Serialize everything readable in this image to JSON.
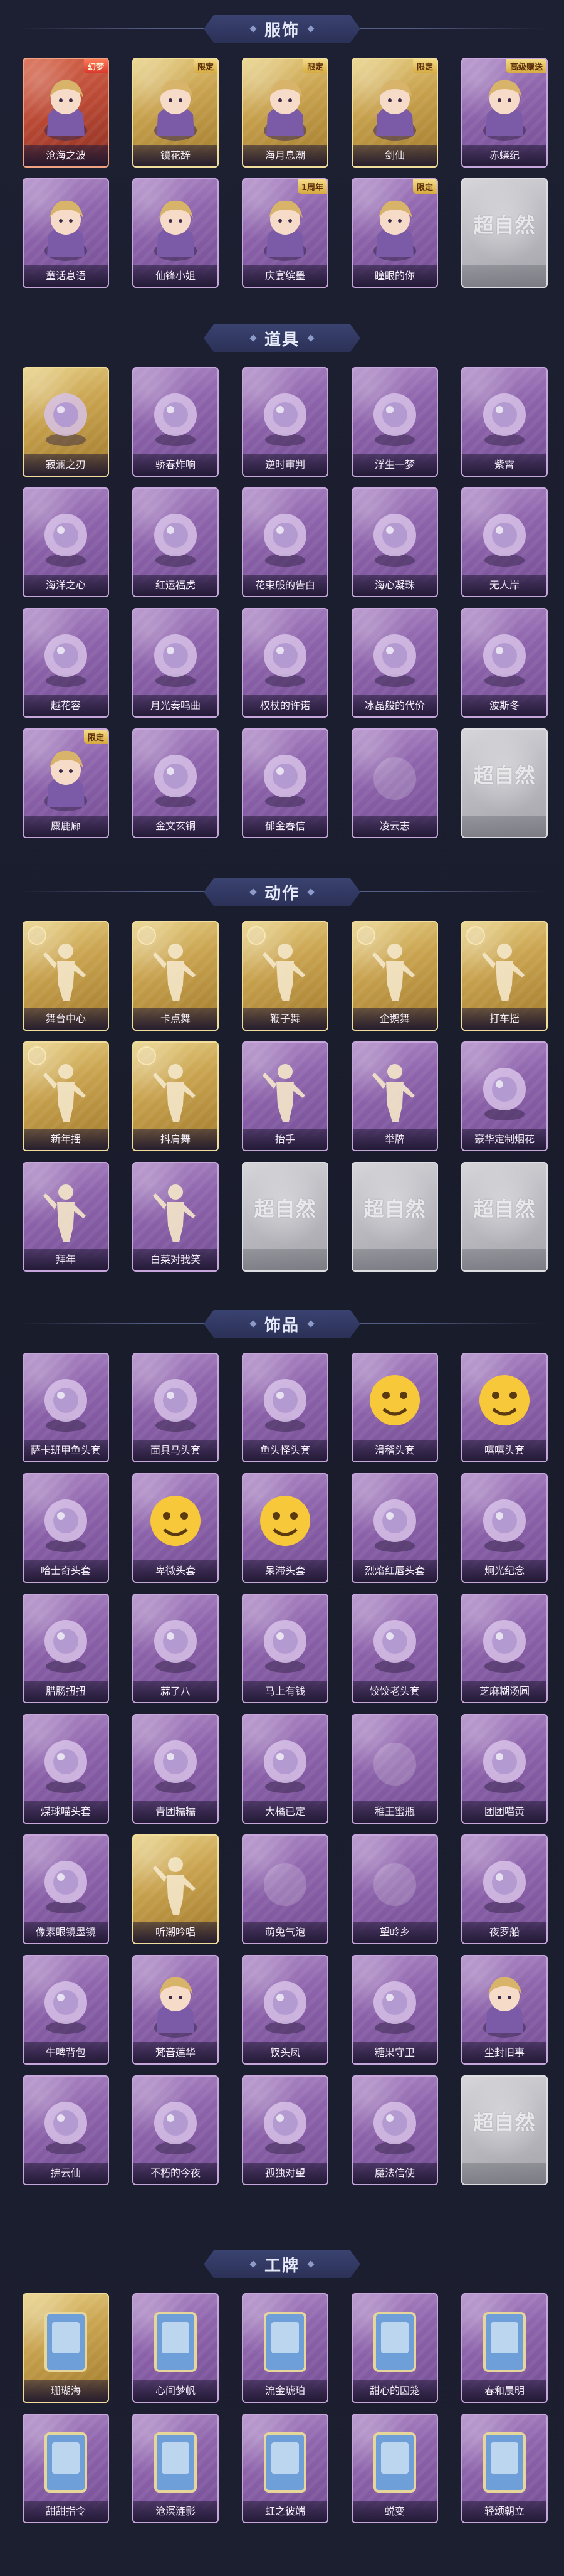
{
  "sections": [
    {
      "title": "服饰",
      "items": [
        {
          "label": "沧海之波",
          "style": "red",
          "badge": "幻梦",
          "icon": "character-icon"
        },
        {
          "label": "镜花辞",
          "style": "gold",
          "badge": "限定",
          "icon": "character-icon"
        },
        {
          "label": "海月息潮",
          "style": "gold",
          "badge": "限定",
          "icon": "character-icon"
        },
        {
          "label": "剑仙",
          "style": "gold",
          "badge": "限定",
          "icon": "character-icon"
        },
        {
          "label": "赤蝶纪",
          "style": "purple",
          "badge": "高级赠送",
          "icon": "character-icon"
        },
        {
          "label": "童话息语",
          "style": "purple",
          "badge": "",
          "icon": "character-icon"
        },
        {
          "label": "仙锋小姐",
          "style": "purple",
          "badge": "",
          "icon": "character-icon"
        },
        {
          "label": "庆宴缤墨",
          "style": "purple",
          "badge": "1周年",
          "icon": "character-icon"
        },
        {
          "label": "瞳眼的你",
          "style": "purple",
          "badge": "限定",
          "icon": "character-icon"
        },
        {
          "label": "",
          "style": "blank",
          "badge": "",
          "icon": "placeholder-icon"
        }
      ]
    },
    {
      "title": "道具",
      "items": [
        {
          "label": "寂澜之刃",
          "style": "gold",
          "badge": "",
          "icon": "blade-icon"
        },
        {
          "label": "骄春炸响",
          "style": "purple",
          "badge": "",
          "icon": "firecracker-icon"
        },
        {
          "label": "逆时审判",
          "style": "purple",
          "badge": "",
          "icon": "pocket-watch-icon"
        },
        {
          "label": "浮生一梦",
          "style": "purple",
          "badge": "",
          "icon": "hourglass-icon"
        },
        {
          "label": "紫霄",
          "style": "purple",
          "badge": "",
          "icon": "necklace-icon"
        },
        {
          "label": "海洋之心",
          "style": "purple",
          "badge": "",
          "icon": "gem-necklace-icon"
        },
        {
          "label": "红运福虎",
          "style": "purple",
          "badge": "",
          "icon": "tiger-icon"
        },
        {
          "label": "花束般的告白",
          "style": "purple",
          "badge": "",
          "icon": "rose-icon"
        },
        {
          "label": "海心凝珠",
          "style": "purple",
          "badge": "",
          "icon": "shell-pearl-icon"
        },
        {
          "label": "无人岸",
          "style": "purple",
          "badge": "",
          "icon": "music-box-icon"
        },
        {
          "label": "越花容",
          "style": "purple",
          "badge": "",
          "icon": "hairpin-icon"
        },
        {
          "label": "月光奏鸣曲",
          "style": "purple",
          "badge": "",
          "icon": "piano-icon"
        },
        {
          "label": "权杖的许诺",
          "style": "purple",
          "badge": "",
          "icon": "scepter-icon"
        },
        {
          "label": "冰晶般的代价",
          "style": "purple",
          "badge": "",
          "icon": "ice-flower-icon"
        },
        {
          "label": "波斯冬",
          "style": "purple",
          "badge": "",
          "icon": "staff-icon"
        },
        {
          "label": "麋鹿廊",
          "style": "purple",
          "badge": "限定",
          "icon": "girl-icon"
        },
        {
          "label": "金文玄铜",
          "style": "purple",
          "badge": "",
          "icon": "bronze-vessel-icon"
        },
        {
          "label": "郁金春信",
          "style": "purple",
          "badge": "",
          "icon": "fan-icon"
        },
        {
          "label": "凌云志",
          "style": "purple",
          "badge": "",
          "icon": "placeholder-icon"
        },
        {
          "label": "",
          "style": "blank",
          "badge": "",
          "icon": "placeholder-icon"
        }
      ]
    },
    {
      "title": "动作",
      "items": [
        {
          "label": "舞台中心",
          "style": "gold",
          "badge": "",
          "icon": "pose-icon"
        },
        {
          "label": "卡点舞",
          "style": "gold",
          "badge": "",
          "icon": "pose-icon"
        },
        {
          "label": "鞭子舞",
          "style": "gold",
          "badge": "",
          "icon": "pose-icon"
        },
        {
          "label": "企鹅舞",
          "style": "gold",
          "badge": "",
          "icon": "pose-icon"
        },
        {
          "label": "打车摇",
          "style": "gold",
          "badge": "",
          "icon": "pose-icon"
        },
        {
          "label": "新年摇",
          "style": "gold",
          "badge": "",
          "icon": "pose-icon"
        },
        {
          "label": "抖肩舞",
          "style": "gold",
          "badge": "",
          "icon": "pose-icon"
        },
        {
          "label": "抬手",
          "style": "purple",
          "badge": "",
          "icon": "pose-icon"
        },
        {
          "label": "举牌",
          "style": "purple",
          "badge": "",
          "icon": "sign-pose-icon"
        },
        {
          "label": "豪华定制烟花",
          "style": "purple",
          "badge": "",
          "icon": "fireworks-icon"
        },
        {
          "label": "拜年",
          "style": "purple",
          "badge": "",
          "icon": "pose-icon"
        },
        {
          "label": "白菜对我笑",
          "style": "purple",
          "badge": "",
          "icon": "pose-icon"
        },
        {
          "label": "",
          "style": "blank",
          "badge": "",
          "icon": "placeholder-icon"
        },
        {
          "label": "",
          "style": "blank",
          "badge": "",
          "icon": "placeholder-icon"
        },
        {
          "label": "",
          "style": "blank",
          "badge": "",
          "icon": "placeholder-icon"
        }
      ]
    },
    {
      "title": "饰品",
      "items": [
        {
          "label": "萨卡班甲鱼头套",
          "style": "purple",
          "badge": "",
          "icon": "fish-head-icon"
        },
        {
          "label": "面具马头套",
          "style": "purple",
          "badge": "",
          "icon": "horse-head-icon"
        },
        {
          "label": "鱼头怪头套",
          "style": "purple",
          "badge": "",
          "icon": "green-fish-head-icon"
        },
        {
          "label": "滑稽头套",
          "style": "purple",
          "badge": "",
          "icon": "emoji-face-icon"
        },
        {
          "label": "嘻嘻头套",
          "style": "purple",
          "badge": "",
          "icon": "emoji-face-icon"
        },
        {
          "label": "哈士奇头套",
          "style": "purple",
          "badge": "",
          "icon": "husky-head-icon"
        },
        {
          "label": "卑微头套",
          "style": "purple",
          "badge": "",
          "icon": "emoji-face-icon"
        },
        {
          "label": "呆滞头套",
          "style": "purple",
          "badge": "",
          "icon": "emoji-face-icon"
        },
        {
          "label": "烈焰红唇头套",
          "style": "purple",
          "badge": "",
          "icon": "pikachu-head-icon"
        },
        {
          "label": "炯光纪念",
          "style": "purple",
          "badge": "",
          "icon": "cake-head-icon"
        },
        {
          "label": "腊肠扭扭",
          "style": "purple",
          "badge": "",
          "icon": "dog-icon"
        },
        {
          "label": "蒜了八",
          "style": "purple",
          "badge": "",
          "icon": "garlic-icon"
        },
        {
          "label": "马上有钱",
          "style": "purple",
          "badge": "",
          "icon": "red-horse-icon"
        },
        {
          "label": "饺饺老头套",
          "style": "purple",
          "badge": "",
          "icon": "dumpling-icon"
        },
        {
          "label": "芝麻糊汤圆",
          "style": "purple",
          "badge": "",
          "icon": "tangyuan-icon"
        },
        {
          "label": "煤球喵头套",
          "style": "purple",
          "badge": "",
          "icon": "cat-head-icon"
        },
        {
          "label": "青团糯糯",
          "style": "purple",
          "badge": "",
          "icon": "qingtuan-icon"
        },
        {
          "label": "大橘已定",
          "style": "purple",
          "badge": "",
          "icon": "orange-icon"
        },
        {
          "label": "稚王蜜瓶",
          "style": "purple",
          "badge": "",
          "icon": "placeholder-icon"
        },
        {
          "label": "团团喵黄",
          "style": "purple",
          "badge": "",
          "icon": "yellow-cat-icon"
        },
        {
          "label": "像素眼镜墨镜",
          "style": "purple",
          "badge": "",
          "icon": "pixel-sunglasses-icon"
        },
        {
          "label": "听潮吟唱",
          "style": "gold",
          "badge": "",
          "icon": "pose-icon"
        },
        {
          "label": "萌兔气泡",
          "style": "purple",
          "badge": "",
          "icon": "placeholder-icon"
        },
        {
          "label": "望岭乡",
          "style": "purple",
          "badge": "",
          "icon": "placeholder-icon"
        },
        {
          "label": "夜罗船",
          "style": "purple",
          "badge": "",
          "icon": "jellyfish-icon"
        },
        {
          "label": "牛啤背包",
          "style": "purple",
          "badge": "",
          "icon": "backpack-icon"
        },
        {
          "label": "梵音莲华",
          "style": "purple",
          "badge": "",
          "icon": "doll-icon"
        },
        {
          "label": "钗头凤",
          "style": "purple",
          "badge": "",
          "icon": "phoenix-icon"
        },
        {
          "label": "糖果守卫",
          "style": "purple",
          "badge": "",
          "icon": "lantern-icon"
        },
        {
          "label": "尘封旧事",
          "style": "purple",
          "badge": "",
          "icon": "doll-icon"
        },
        {
          "label": "拂云仙",
          "style": "purple",
          "badge": "",
          "icon": "pendant-icon"
        },
        {
          "label": "不朽的今夜",
          "style": "purple",
          "badge": "",
          "icon": "pendant-icon"
        },
        {
          "label": "孤独对望",
          "style": "purple",
          "badge": "",
          "icon": "pendant-icon"
        },
        {
          "label": "魔法信使",
          "style": "purple",
          "badge": "",
          "icon": "mouse-doll-icon"
        },
        {
          "label": "",
          "style": "blank",
          "badge": "",
          "icon": "placeholder-icon"
        }
      ]
    },
    {
      "title": "工牌",
      "items": [
        {
          "label": "珊瑚海",
          "style": "gold",
          "badge": "",
          "icon": "card-icon"
        },
        {
          "label": "心间梦帆",
          "style": "purple",
          "badge": "",
          "icon": "card-icon"
        },
        {
          "label": "流金琥珀",
          "style": "purple",
          "badge": "",
          "icon": "card-icon"
        },
        {
          "label": "甜心的囚笼",
          "style": "purple",
          "badge": "",
          "icon": "card-icon"
        },
        {
          "label": "春和晨明",
          "style": "purple",
          "badge": "",
          "icon": "card-icon"
        },
        {
          "label": "甜甜指令",
          "style": "purple",
          "badge": "",
          "icon": "card-icon"
        },
        {
          "label": "沧溟涟影",
          "style": "purple",
          "badge": "",
          "icon": "card-icon"
        },
        {
          "label": "虹之彼端",
          "style": "purple",
          "badge": "",
          "icon": "card-icon"
        },
        {
          "label": "蜕变",
          "style": "purple",
          "badge": "",
          "icon": "card-icon"
        },
        {
          "label": "轻颂朝立",
          "style": "purple",
          "badge": "",
          "icon": "card-icon"
        }
      ]
    }
  ],
  "placeholder_mark": "超自然",
  "colors": {
    "background": "#1b1e2e",
    "header": "#2b3157",
    "purple_card": "#8e64ac",
    "gold_card": "#c9a34f",
    "blank_card": "#b9b9bf"
  }
}
